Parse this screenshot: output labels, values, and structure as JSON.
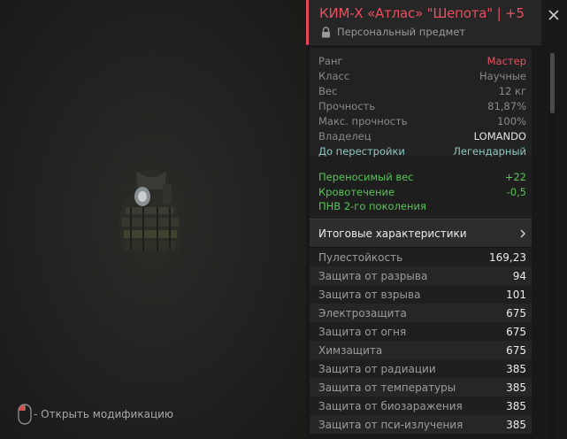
{
  "hint": {
    "text": "- Открыть модификацию",
    "icon": "mouse-icon"
  },
  "header": {
    "title": "КИМ-Х «Атлас» \"Шепота\" | +5",
    "subtitle": "Персональный предмет",
    "accent": "#e44a5a"
  },
  "base_stats": [
    {
      "label": "Ранг",
      "value": "Мастер"
    },
    {
      "label": "Класс",
      "value": "Научные"
    },
    {
      "label": "Вес",
      "value": "12 кг"
    },
    {
      "label": "Прочность",
      "value": "81,87%"
    },
    {
      "label": "Макс. прочность",
      "value": "100%"
    },
    {
      "label": "Владелец",
      "value": "LOMANDO"
    },
    {
      "label": "До перестройки",
      "value": "Легендарный"
    }
  ],
  "bonuses": [
    {
      "label": "Переносимый вес",
      "value": "+22"
    },
    {
      "label": "Кровотечение",
      "value": "-0,5"
    },
    {
      "label": "ПНВ 2-го поколения",
      "value": ""
    }
  ],
  "summary": {
    "label": "Итоговые характеристики"
  },
  "protection": [
    {
      "label": "Пулестойкость",
      "value": "169,23"
    },
    {
      "label": "Защита от разрыва",
      "value": "94"
    },
    {
      "label": "Защита от взрыва",
      "value": "101"
    },
    {
      "label": "Электрозащита",
      "value": "675"
    },
    {
      "label": "Защита от огня",
      "value": "675"
    },
    {
      "label": "Химзащита",
      "value": "675"
    },
    {
      "label": "Защита от радиации",
      "value": "385"
    },
    {
      "label": "Защита от температуры",
      "value": "385"
    },
    {
      "label": "Защита от биозаражения",
      "value": "385"
    },
    {
      "label": "Защита от пси-излучения",
      "value": "385"
    }
  ],
  "colors": {
    "rank": "#e9505f",
    "bonus": "#58c457",
    "rebuild": "#8fc7c2"
  }
}
